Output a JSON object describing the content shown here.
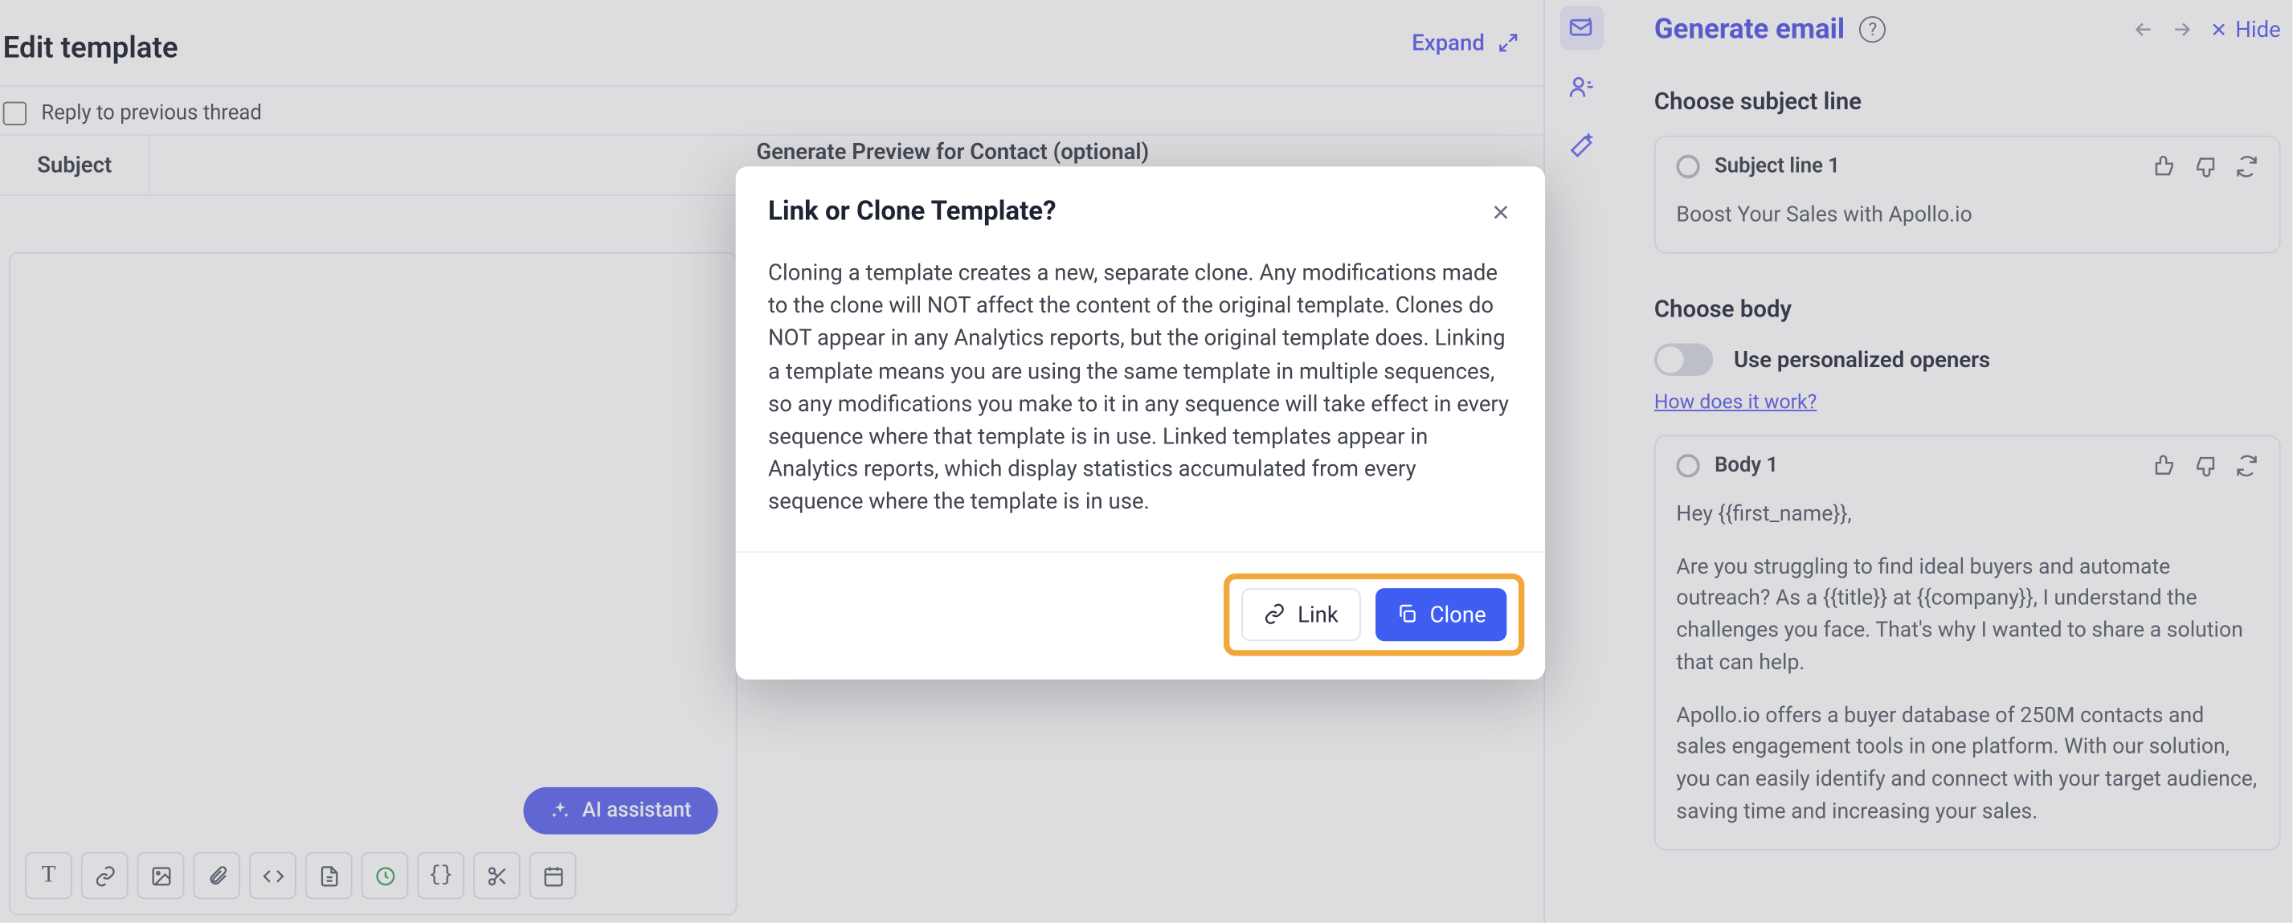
{
  "main": {
    "title": "Edit template",
    "expand": "Expand",
    "reply_label": "Reply to previous thread",
    "subject_label": "Subject",
    "generate_preview": "Generate Preview for Contact (optional)",
    "ai_assistant": "AI assistant"
  },
  "right": {
    "title": "Generate email",
    "hide": "Hide",
    "subject_section": "Choose subject line",
    "subject1_title": "Subject line 1",
    "subject1_text": "Boost Your Sales with Apollo.io",
    "body_section": "Choose body",
    "toggle_label": "Use personalized openers",
    "how_link": "How does it work?",
    "body1_title": "Body 1",
    "body1_greeting": "Hey {{first_name}},",
    "body1_p1": "Are you struggling to find ideal buyers and automate outreach? As a {{title}} at {{company}}, I understand the challenges you face. That's why I wanted to share a solution that can help.",
    "body1_p2": "Apollo.io offers a buyer database of 250M contacts and sales engagement tools in one platform. With our solution, you can easily identify and connect with your target audience, saving time and increasing your sales."
  },
  "modal": {
    "title": "Link or Clone Template?",
    "body": "Cloning a template creates a new, separate clone. Any modifications made to the clone will NOT affect the content of the original template. Clones do NOT appear in any Analytics reports, but the original template does. Linking a template means you are using the same template in multiple sequences, so any modifications you make to it in any sequence will take effect in every sequence where that template is in use. Linked templates appear in Analytics reports, which display statistics accumulated from every sequence where the template is in use.",
    "link_btn": "Link",
    "clone_btn": "Clone"
  },
  "toolbar_icons": [
    "text-format",
    "link",
    "image",
    "attachment",
    "code",
    "meeting",
    "variables",
    "scissors",
    "calendar"
  ]
}
